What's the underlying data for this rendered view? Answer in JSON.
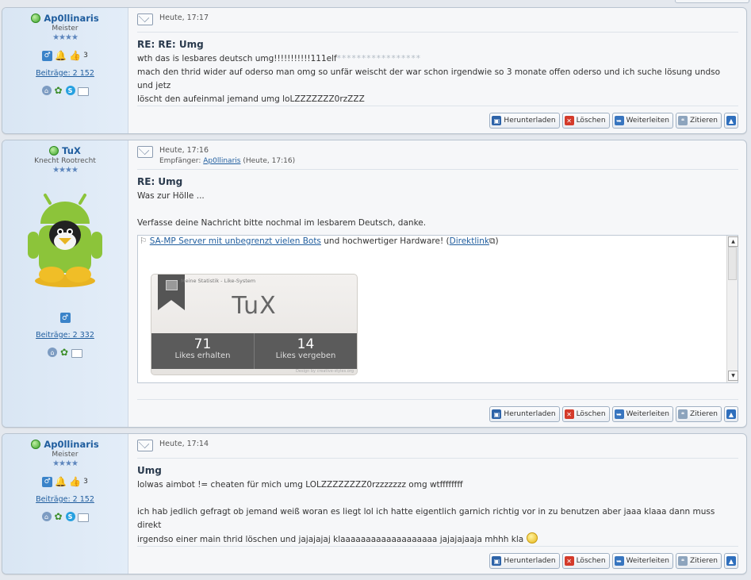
{
  "posts": [
    {
      "author": "Ap0llinaris",
      "rank": "Meister",
      "stars": "★★★★",
      "badge_count": "3",
      "beitraege": "Beiträge: 2 152",
      "date": "Heute, 17:17",
      "recipient": "",
      "title": "RE: RE: Umg",
      "body_lines": [
        "wth das is lesbares deutsch umg!!!!!!!!!!!111elf",
        "mach den thrid wider auf oderso man omg so unfär weischt der war schon irgendwie so 3 monate offen oderso und ich suche lösung undso und jetz",
        "löscht den aufeinmal jemand umg loLZZZZZZZ0rzZZZ"
      ],
      "faint_tail": "*****************"
    },
    {
      "author": "TuX",
      "rank": "Knecht Rootrecht",
      "stars": "★★★★",
      "beitraege": "Beiträge: 2 332",
      "date": "Heute, 17:16",
      "recipient_prefix": "Empfänger: ",
      "recipient_name": "Ap0llinaris",
      "recipient_suffix": " (Heute, 17:16)",
      "title": "RE: Umg",
      "body_lines": [
        "Was zur Hölle ...",
        "",
        "Verfasse deine Nachricht bitte nochmal im lesbarem Deutsch, danke."
      ],
      "signature": {
        "link_text": "SA-MP Server mit unbegrenzt vielen Bots",
        "middle_text": " und hochwertiger Hardware! (",
        "direct_link": "Direktlink",
        "end_text": ")",
        "card": {
          "header": "Meine Statistik - Like-System",
          "name": "TuX",
          "likes_received": "71",
          "likes_received_label": "Likes erhalten",
          "likes_given": "14",
          "likes_given_label": "Likes vergeben",
          "credit": "Design by creative-styles.org"
        }
      }
    },
    {
      "author": "Ap0llinaris",
      "rank": "Meister",
      "stars": "★★★★",
      "badge_count": "3",
      "beitraege": "Beiträge: 2 152",
      "date": "Heute, 17:14",
      "recipient": "",
      "title": "Umg",
      "body_lines": [
        "lolwas aimbot != cheaten für mich umg LOLZZZZZZZZ0rzzzzzzz omg wtffffffff",
        "",
        "ich hab jedlich gefragt ob jemand weiß woran es liegt lol ich hatte eigentlich garnich richtig vor in zu benutzen aber jaaa klaaa dann muss direkt",
        "irgendso einer main thrid löschen und jajajajaj klaaaaaaaaaaaaaaaaaaa jajajajaaja mhhh kla"
      ]
    }
  ],
  "actions": {
    "download": "Herunterladen",
    "delete": "Löschen",
    "forward": "Weiterleiten",
    "quote": "Zitieren"
  },
  "colors": {
    "link": "#1f5d9e",
    "sidebar": "#dde9f6",
    "online": "#3aa12a"
  }
}
